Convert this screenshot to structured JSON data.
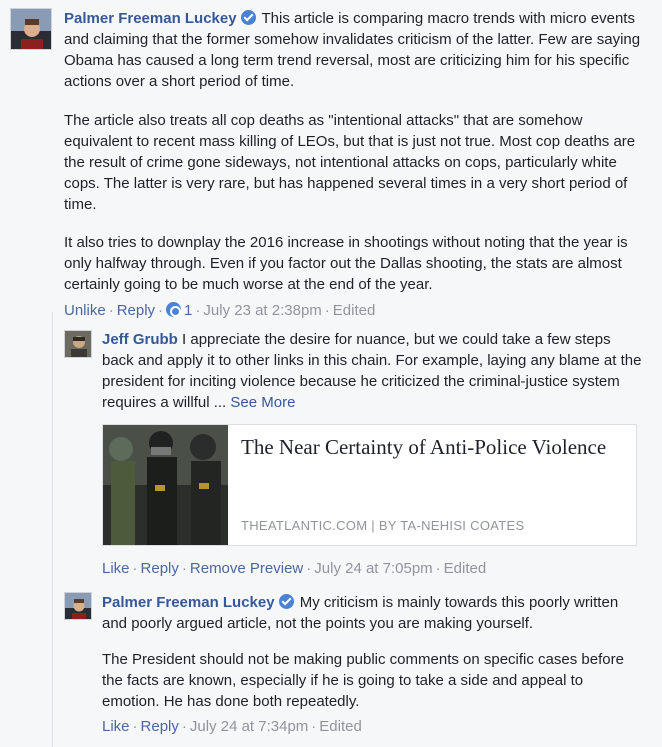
{
  "comment1": {
    "author": "Palmer Freeman Luckey",
    "paragraphs": [
      "This article is comparing macro trends with micro events and claiming that the former somehow invalidates criticism of the latter. Few are saying Obama has caused a long term trend reversal, most are criticizing him for his specific actions over a short period of time.",
      "The article also treats all cop deaths as \"intentional attacks\" that are somehow equivalent to recent mass killing of LEOs, but that is just not true. Most cop deaths are the result of crime gone sideways, not intentional attacks on cops, particularly white cops. The latter is very rare, but has happened several times in a very short period of time.",
      "It also tries to downplay the 2016 increase in shootings without noting that the year is only halfway through. Even if you factor out the Dallas shooting, the stats are almost certainly going to be much worse at the end of the year."
    ],
    "actions": {
      "unlike": "Unlike",
      "reply": "Reply",
      "reaction_count": "1",
      "timestamp": "July 23 at 2:38pm",
      "edited": "Edited"
    }
  },
  "reply1": {
    "author": "Jeff Grubb",
    "text": "I appreciate the desire for nuance, but we could take a few steps back and apply it to other links in this chain. For example, laying any blame at the president for inciting violence because he criticized the criminal-justice system requires a willful ...",
    "see_more": "See More",
    "preview": {
      "title": "The Near Certainty of Anti-Police Violence",
      "source": "THEATLANTIC.COM | BY TA-NEHISI COATES"
    },
    "actions": {
      "like": "Like",
      "reply": "Reply",
      "remove_preview": "Remove Preview",
      "timestamp": "July 24 at 7:05pm",
      "edited": "Edited"
    }
  },
  "reply2": {
    "author": "Palmer Freeman Luckey",
    "paragraphs": [
      "My criticism is mainly towards this poorly written and poorly argued article, not the points you are making yourself.",
      "The President should not be making public comments on specific cases before the facts are known, especially if he is going to take a side and appeal to emotion. He has done both repeatedly."
    ],
    "actions": {
      "like": "Like",
      "reply": "Reply",
      "timestamp": "July 24 at 7:34pm",
      "edited": "Edited"
    }
  },
  "colors": {
    "link": "#365899",
    "meta": "#90949c",
    "verified": "#4b83d4",
    "background": "#f6f7f9"
  }
}
